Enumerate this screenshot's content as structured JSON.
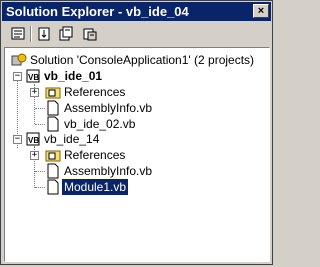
{
  "window": {
    "title": "Solution Explorer - vb_ide_04",
    "close_glyph": "×"
  },
  "toolbar": {
    "buttons": [
      {
        "icon": "view-code-icon"
      },
      {
        "icon": "properties-icon"
      },
      {
        "icon": "show-all-files-icon"
      },
      {
        "icon": "refresh-icon"
      }
    ]
  },
  "tree": {
    "solution": {
      "label": "Solution 'ConsoleApplication1' (2 projects)"
    },
    "projects": [
      {
        "label": "vb_ide_01",
        "children": [
          {
            "label": "References",
            "type": "folder"
          },
          {
            "label": "AssemblyInfo.vb",
            "type": "file"
          },
          {
            "label": "vb_ide_02.vb",
            "type": "file"
          }
        ]
      },
      {
        "label": "vb_ide_14",
        "children": [
          {
            "label": "References",
            "type": "folder"
          },
          {
            "label": "AssemblyInfo.vb",
            "type": "file"
          },
          {
            "label": "Module1.vb",
            "type": "file",
            "selected": true
          }
        ]
      }
    ]
  },
  "colors": {
    "title_bar": "#0a246a",
    "selection": "#0a246a",
    "window_face": "#d4d0c8"
  }
}
